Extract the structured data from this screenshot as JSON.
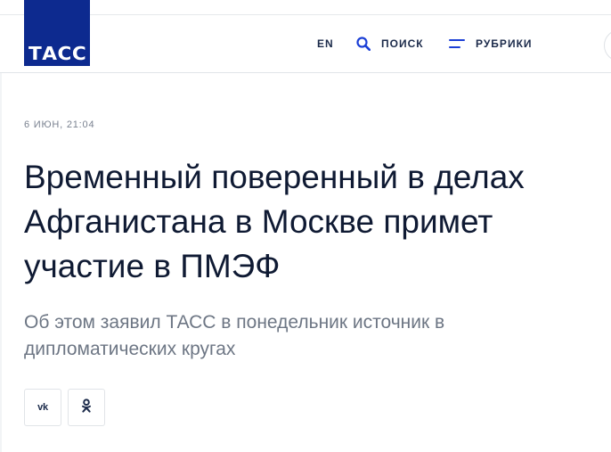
{
  "header": {
    "logo_text": "ТАСС",
    "nav": {
      "lang": "EN",
      "search": "ПОИСК",
      "rubrics": "РУБРИКИ"
    }
  },
  "article": {
    "date": "6 ИЮН, 21:04",
    "title": "Временный поверенный в делах Афганистана в Москве примет участие в ПМЭФ",
    "lead": "Об этом заявил ТАСС в понедельник источник в дипломатических кругах"
  },
  "share": {
    "vk_label": "vk",
    "icons": [
      "vk-icon",
      "odnoklassniki-icon"
    ]
  },
  "colors": {
    "brand": "#0d2a8f",
    "text_dark": "#0f1a33",
    "text_muted": "#6d7684",
    "background": "#f2f4f6"
  }
}
